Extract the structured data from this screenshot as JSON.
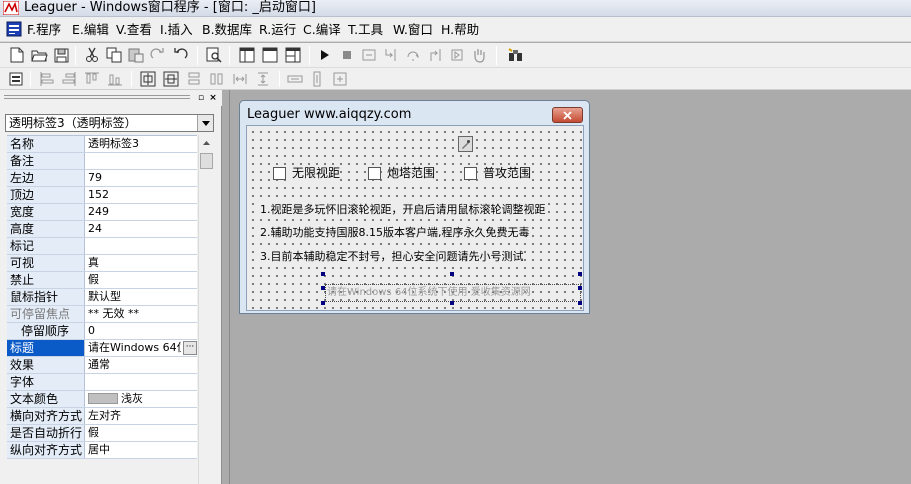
{
  "window": {
    "title": "Leaguer - Windows窗口程序 - [窗口: _启动窗口]"
  },
  "menu": [
    {
      "label": "F.程序"
    },
    {
      "label": "E.编辑"
    },
    {
      "label": "V.查看"
    },
    {
      "label": "I.插入"
    },
    {
      "label": "B.数据库"
    },
    {
      "label": "R.运行"
    },
    {
      "label": "C.编译"
    },
    {
      "label": "T.工具"
    },
    {
      "label": "W.窗口"
    },
    {
      "label": "H.帮助"
    }
  ],
  "toolbar1": [
    "new-file-icon",
    "open-folder-icon",
    "save-icon",
    "cut-icon",
    "copy-icon",
    "paste-icon",
    "redo-icon",
    "undo-icon",
    "find-icon",
    "layout-left-icon",
    "layout-full-icon",
    "layout-right-icon",
    "run-icon",
    "stop-icon",
    "step-icon",
    "step-into-icon",
    "step-over-icon",
    "step-out-icon",
    "hand-icon",
    "binoculars-icon"
  ],
  "toolbar2": [
    "form-icon",
    "align-left-icon",
    "align-right-icon",
    "align-top-icon",
    "align-bottom-icon",
    "center-horizontal-icon",
    "center-vertical-icon",
    "same-width-icon",
    "same-height-icon",
    "spacing-horizontal-icon",
    "spacing-vertical-icon",
    "size-icon"
  ],
  "panel": {
    "selector_value": "透明标签3（透明标签）",
    "properties": [
      {
        "name": "名称",
        "value": "透明标签3"
      },
      {
        "name": "备注",
        "value": ""
      },
      {
        "name": "左边",
        "value": "79"
      },
      {
        "name": "顶边",
        "value": "152"
      },
      {
        "name": "宽度",
        "value": "249"
      },
      {
        "name": "高度",
        "value": "24"
      },
      {
        "name": "标记",
        "value": ""
      },
      {
        "name": "可视",
        "value": "真"
      },
      {
        "name": "禁止",
        "value": "假"
      },
      {
        "name": "鼠标指针",
        "value": "默认型"
      },
      {
        "name": "可停留焦点",
        "value": "** 无效 **"
      },
      {
        "name": "停留顺序",
        "value": "0"
      },
      {
        "name": "标题",
        "value": "请在Windows 64位"
      },
      {
        "name": "效果",
        "value": "通常"
      },
      {
        "name": "字体",
        "value": ""
      },
      {
        "name": "文本颜色",
        "value": "浅灰"
      },
      {
        "name": "横向对齐方式",
        "value": "左对齐"
      },
      {
        "name": "是否自动折行",
        "value": "假"
      },
      {
        "name": "纵向对齐方式",
        "value": "居中"
      }
    ]
  },
  "form": {
    "title": "Leaguer www.aiqqzy.com",
    "checkboxes": [
      {
        "label": "无限视距",
        "checked": false
      },
      {
        "label": "炮塔范围",
        "checked": false
      },
      {
        "label": "普攻范围",
        "checked": false
      }
    ],
    "lines": [
      "1.视距是多玩怀旧滚轮视距，开启后请用鼠标滚轮调整视距",
      "2.辅助功能支持国服8.15版本客户端,程序永久免费无毒",
      "3.目前本辅助稳定不封号，担心安全问题请先小号测试"
    ],
    "notice": "请在Windows 64位系统下使用  爱收集资源网"
  },
  "colors": {
    "selected_row": "#0a5ac8",
    "name_column": "#e4ecf7",
    "workspace": "#ababab",
    "handle": "#000080"
  }
}
